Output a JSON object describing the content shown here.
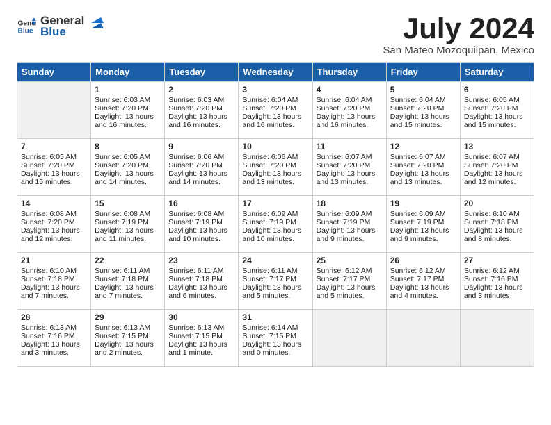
{
  "header": {
    "logo_general": "General",
    "logo_blue": "Blue",
    "month_title": "July 2024",
    "location": "San Mateo Mozoquilpan, Mexico"
  },
  "weekdays": [
    "Sunday",
    "Monday",
    "Tuesday",
    "Wednesday",
    "Thursday",
    "Friday",
    "Saturday"
  ],
  "weeks": [
    [
      {
        "day": "",
        "sunrise": "",
        "sunset": "",
        "daylight": ""
      },
      {
        "day": "1",
        "sunrise": "Sunrise: 6:03 AM",
        "sunset": "Sunset: 7:20 PM",
        "daylight": "Daylight: 13 hours and 16 minutes."
      },
      {
        "day": "2",
        "sunrise": "Sunrise: 6:03 AM",
        "sunset": "Sunset: 7:20 PM",
        "daylight": "Daylight: 13 hours and 16 minutes."
      },
      {
        "day": "3",
        "sunrise": "Sunrise: 6:04 AM",
        "sunset": "Sunset: 7:20 PM",
        "daylight": "Daylight: 13 hours and 16 minutes."
      },
      {
        "day": "4",
        "sunrise": "Sunrise: 6:04 AM",
        "sunset": "Sunset: 7:20 PM",
        "daylight": "Daylight: 13 hours and 16 minutes."
      },
      {
        "day": "5",
        "sunrise": "Sunrise: 6:04 AM",
        "sunset": "Sunset: 7:20 PM",
        "daylight": "Daylight: 13 hours and 15 minutes."
      },
      {
        "day": "6",
        "sunrise": "Sunrise: 6:05 AM",
        "sunset": "Sunset: 7:20 PM",
        "daylight": "Daylight: 13 hours and 15 minutes."
      }
    ],
    [
      {
        "day": "7",
        "sunrise": "Sunrise: 6:05 AM",
        "sunset": "Sunset: 7:20 PM",
        "daylight": "Daylight: 13 hours and 15 minutes."
      },
      {
        "day": "8",
        "sunrise": "Sunrise: 6:05 AM",
        "sunset": "Sunset: 7:20 PM",
        "daylight": "Daylight: 13 hours and 14 minutes."
      },
      {
        "day": "9",
        "sunrise": "Sunrise: 6:06 AM",
        "sunset": "Sunset: 7:20 PM",
        "daylight": "Daylight: 13 hours and 14 minutes."
      },
      {
        "day": "10",
        "sunrise": "Sunrise: 6:06 AM",
        "sunset": "Sunset: 7:20 PM",
        "daylight": "Daylight: 13 hours and 13 minutes."
      },
      {
        "day": "11",
        "sunrise": "Sunrise: 6:07 AM",
        "sunset": "Sunset: 7:20 PM",
        "daylight": "Daylight: 13 hours and 13 minutes."
      },
      {
        "day": "12",
        "sunrise": "Sunrise: 6:07 AM",
        "sunset": "Sunset: 7:20 PM",
        "daylight": "Daylight: 13 hours and 13 minutes."
      },
      {
        "day": "13",
        "sunrise": "Sunrise: 6:07 AM",
        "sunset": "Sunset: 7:20 PM",
        "daylight": "Daylight: 13 hours and 12 minutes."
      }
    ],
    [
      {
        "day": "14",
        "sunrise": "Sunrise: 6:08 AM",
        "sunset": "Sunset: 7:20 PM",
        "daylight": "Daylight: 13 hours and 12 minutes."
      },
      {
        "day": "15",
        "sunrise": "Sunrise: 6:08 AM",
        "sunset": "Sunset: 7:19 PM",
        "daylight": "Daylight: 13 hours and 11 minutes."
      },
      {
        "day": "16",
        "sunrise": "Sunrise: 6:08 AM",
        "sunset": "Sunset: 7:19 PM",
        "daylight": "Daylight: 13 hours and 10 minutes."
      },
      {
        "day": "17",
        "sunrise": "Sunrise: 6:09 AM",
        "sunset": "Sunset: 7:19 PM",
        "daylight": "Daylight: 13 hours and 10 minutes."
      },
      {
        "day": "18",
        "sunrise": "Sunrise: 6:09 AM",
        "sunset": "Sunset: 7:19 PM",
        "daylight": "Daylight: 13 hours and 9 minutes."
      },
      {
        "day": "19",
        "sunrise": "Sunrise: 6:09 AM",
        "sunset": "Sunset: 7:19 PM",
        "daylight": "Daylight: 13 hours and 9 minutes."
      },
      {
        "day": "20",
        "sunrise": "Sunrise: 6:10 AM",
        "sunset": "Sunset: 7:18 PM",
        "daylight": "Daylight: 13 hours and 8 minutes."
      }
    ],
    [
      {
        "day": "21",
        "sunrise": "Sunrise: 6:10 AM",
        "sunset": "Sunset: 7:18 PM",
        "daylight": "Daylight: 13 hours and 7 minutes."
      },
      {
        "day": "22",
        "sunrise": "Sunrise: 6:11 AM",
        "sunset": "Sunset: 7:18 PM",
        "daylight": "Daylight: 13 hours and 7 minutes."
      },
      {
        "day": "23",
        "sunrise": "Sunrise: 6:11 AM",
        "sunset": "Sunset: 7:18 PM",
        "daylight": "Daylight: 13 hours and 6 minutes."
      },
      {
        "day": "24",
        "sunrise": "Sunrise: 6:11 AM",
        "sunset": "Sunset: 7:17 PM",
        "daylight": "Daylight: 13 hours and 5 minutes."
      },
      {
        "day": "25",
        "sunrise": "Sunrise: 6:12 AM",
        "sunset": "Sunset: 7:17 PM",
        "daylight": "Daylight: 13 hours and 5 minutes."
      },
      {
        "day": "26",
        "sunrise": "Sunrise: 6:12 AM",
        "sunset": "Sunset: 7:17 PM",
        "daylight": "Daylight: 13 hours and 4 minutes."
      },
      {
        "day": "27",
        "sunrise": "Sunrise: 6:12 AM",
        "sunset": "Sunset: 7:16 PM",
        "daylight": "Daylight: 13 hours and 3 minutes."
      }
    ],
    [
      {
        "day": "28",
        "sunrise": "Sunrise: 6:13 AM",
        "sunset": "Sunset: 7:16 PM",
        "daylight": "Daylight: 13 hours and 3 minutes."
      },
      {
        "day": "29",
        "sunrise": "Sunrise: 6:13 AM",
        "sunset": "Sunset: 7:15 PM",
        "daylight": "Daylight: 13 hours and 2 minutes."
      },
      {
        "day": "30",
        "sunrise": "Sunrise: 6:13 AM",
        "sunset": "Sunset: 7:15 PM",
        "daylight": "Daylight: 13 hours and 1 minute."
      },
      {
        "day": "31",
        "sunrise": "Sunrise: 6:14 AM",
        "sunset": "Sunset: 7:15 PM",
        "daylight": "Daylight: 13 hours and 0 minutes."
      },
      {
        "day": "",
        "sunrise": "",
        "sunset": "",
        "daylight": ""
      },
      {
        "day": "",
        "sunrise": "",
        "sunset": "",
        "daylight": ""
      },
      {
        "day": "",
        "sunrise": "",
        "sunset": "",
        "daylight": ""
      }
    ]
  ]
}
